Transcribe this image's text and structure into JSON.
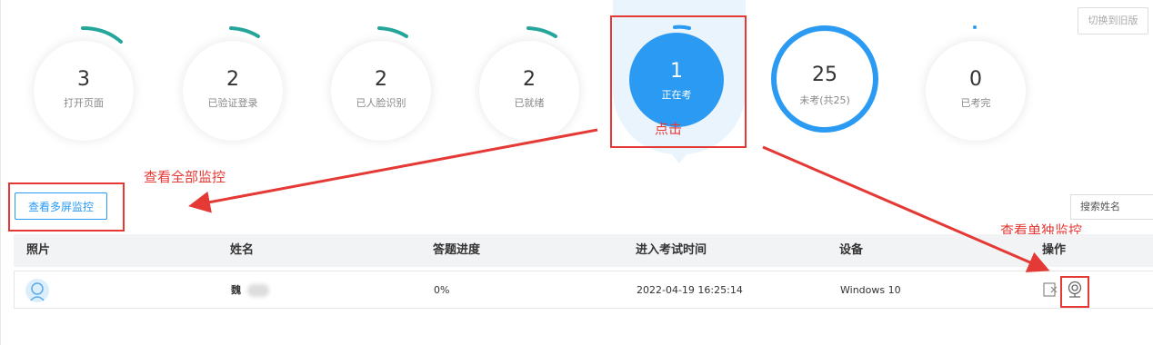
{
  "stats": [
    {
      "value": "3",
      "label": "打开页面"
    },
    {
      "value": "2",
      "label": "已验证登录"
    },
    {
      "value": "2",
      "label": "已人脸识别"
    },
    {
      "value": "2",
      "label": "已就绪"
    },
    {
      "value": "1",
      "label": "正在考"
    },
    {
      "value": "25",
      "label": "未考(共25)"
    },
    {
      "value": "0",
      "label": "已考完"
    }
  ],
  "switch_button": "切换到旧版",
  "multi_monitor_button": "查看多屏监控",
  "search_placeholder": "搜索姓名",
  "annotations": {
    "click": "点击",
    "view_all": "查看全部监控",
    "view_single": "查看单独监控"
  },
  "table": {
    "columns": [
      "照片",
      "姓名",
      "答题进度",
      "进入考试时间",
      "设备",
      "操作"
    ],
    "rows": [
      {
        "name": "魏",
        "progress": "0%",
        "enter_time": "2022-04-19 16:25:14",
        "device": "Windows 10"
      }
    ]
  },
  "colors": {
    "accent": "#2b9af3",
    "teal": "#26a69a",
    "annotation_red": "#e53935"
  }
}
